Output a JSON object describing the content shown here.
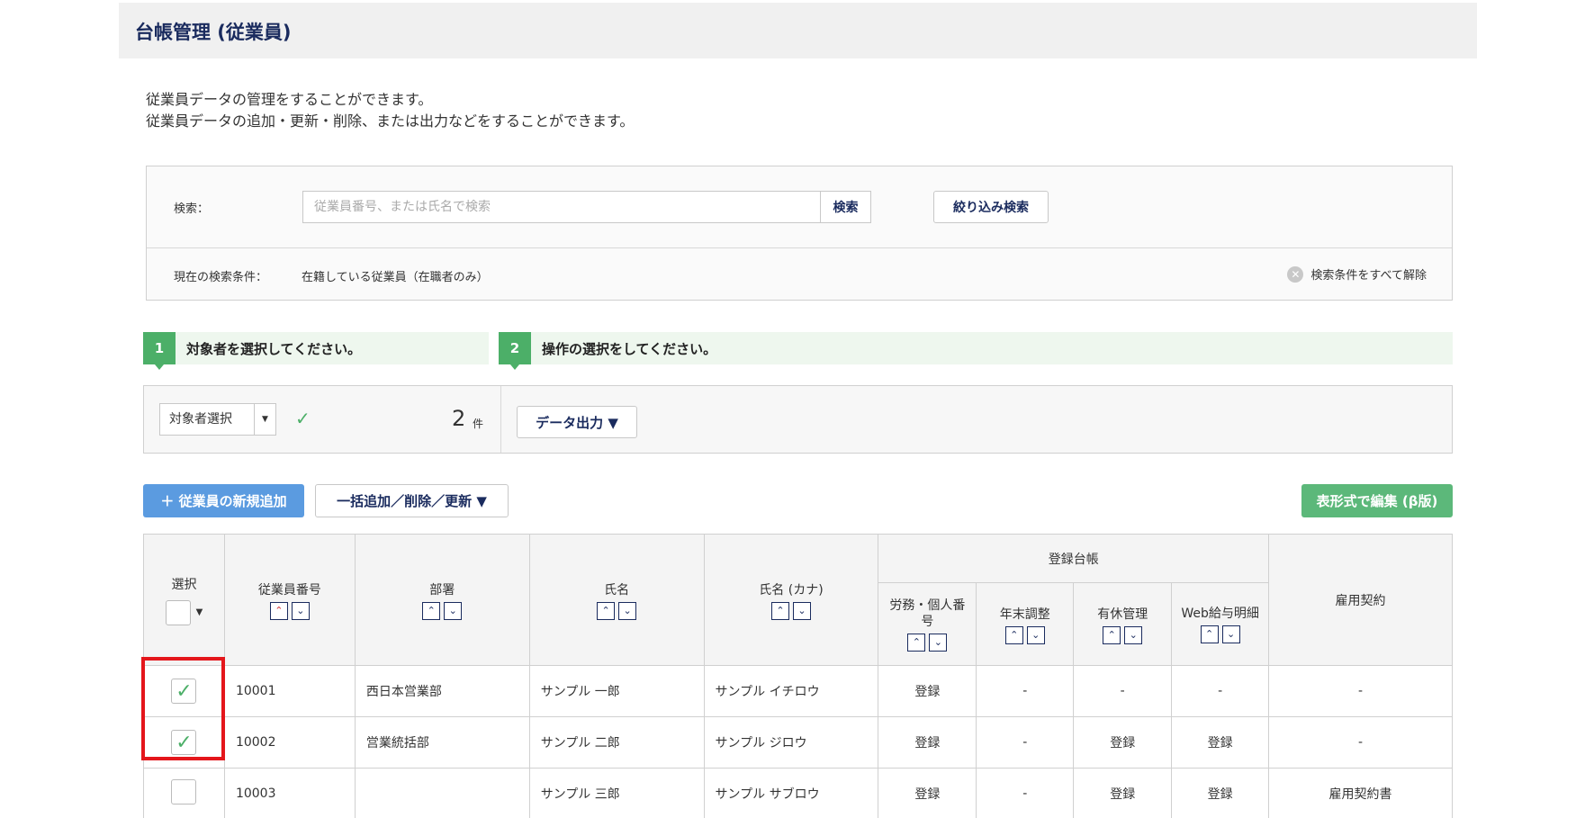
{
  "header": {
    "title": "台帳管理 (従業員)"
  },
  "intro": {
    "line1": "従業員データの管理をすることができます。",
    "line2": "従業員データの追加・更新・削除、または出力などをすることができます。"
  },
  "search": {
    "label": "検索：",
    "placeholder": "従業員番号、または氏名で検索",
    "value": "",
    "search_button": "検索",
    "filter_button": "絞り込み検索",
    "condition_label": "現在の検索条件：",
    "condition_value": "在籍している従業員（在職者のみ）",
    "clear_label": "検索条件をすべて解除",
    "clear_icon": "close-circle-icon"
  },
  "steps": [
    {
      "num": "1",
      "text": "対象者を選択してください。"
    },
    {
      "num": "2",
      "text": "操作の選択をしてください。"
    }
  ],
  "operation": {
    "select_label": "対象者選択",
    "count": "2",
    "count_unit": "件",
    "export_label": "データ出力 ▼"
  },
  "toolbar": {
    "add_label": "＋ 従業員の新規追加",
    "bulk_label": "一括追加／削除／更新 ▼",
    "table_edit_label": "表形式で編集 (β版)"
  },
  "table": {
    "headers": {
      "select": "選択",
      "emp_no": "従業員番号",
      "dept": "部署",
      "name": "氏名",
      "kana": "氏名 (カナ)",
      "registry": "登録台帳",
      "labor": "労務・個人番号",
      "year_end": "年末調整",
      "leave": "有休管理",
      "web_pay": "Web給与明細",
      "contract": "雇用契約"
    },
    "rows": [
      {
        "checked": "✓",
        "emp_no": "10001",
        "dept": "西日本営業部",
        "name": "サンプル 一郎",
        "kana": "サンプル イチロウ",
        "labor": "登録",
        "year_end": "-",
        "leave": "-",
        "web_pay": "-",
        "contract": "-"
      },
      {
        "checked": "✓",
        "emp_no": "10002",
        "dept": "営業統括部",
        "name": "サンプル 二郎",
        "kana": "サンプル ジロウ",
        "labor": "登録",
        "year_end": "-",
        "leave": "登録",
        "web_pay": "登録",
        "contract": "-"
      },
      {
        "checked": "",
        "emp_no": "10003",
        "dept": "",
        "name": "サンプル 三郎",
        "kana": "サンプル サブロウ",
        "labor": "登録",
        "year_end": "-",
        "leave": "登録",
        "web_pay": "登録",
        "contract": "雇用契約書"
      }
    ]
  }
}
